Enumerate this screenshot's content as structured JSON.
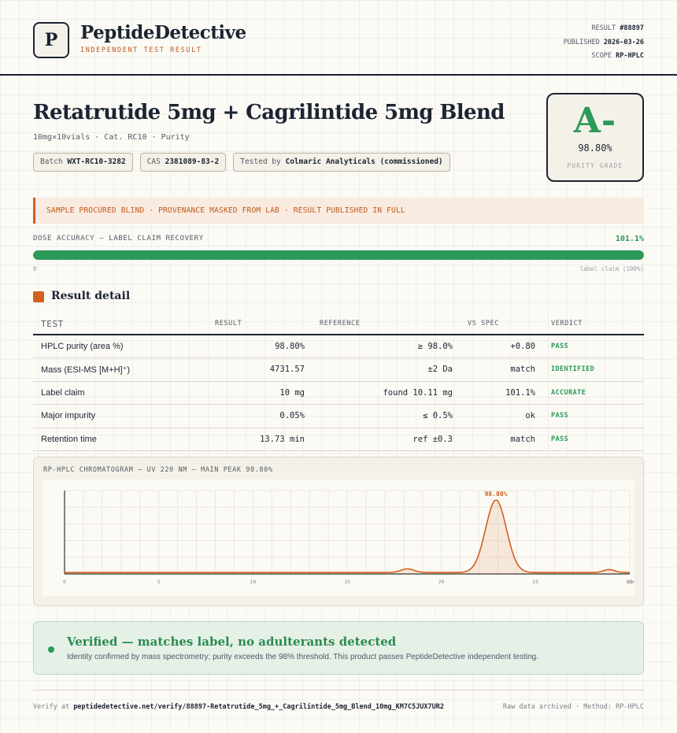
{
  "brand": {
    "logo_letter": "P",
    "name": "PeptideDetective",
    "tagline": "INDEPENDENT TEST RESULT"
  },
  "meta": {
    "result_label": "RESULT",
    "result_value": "#88897",
    "published_label": "PUBLISHED",
    "published_value": "2026-03-26",
    "scope_label": "SCOPE",
    "scope_value": "RP-HPLC"
  },
  "product": {
    "title": "Retatrutide 5mg + Cagrilintide 5mg Blend",
    "subtitle": "10mg×10vials · Cat. RC10 · Purity",
    "chips": [
      {
        "label": "Batch",
        "value": "WXT-RC10-3282"
      },
      {
        "label": "CAS",
        "value": "2381089-83-2"
      },
      {
        "label": "Tested by",
        "value": "Colmaric Analyticals (commissioned)"
      }
    ]
  },
  "grade": {
    "letter": "A-",
    "percent": "98.80%",
    "label": "PURITY GRADE",
    "color": "#2b9a58"
  },
  "banner": {
    "text": "SAMPLE PROCURED BLIND · PROVENANCE MASKED FROM LAB · RESULT PUBLISHED IN FULL"
  },
  "dose": {
    "label": "DOSE ACCURACY — LABEL CLAIM RECOVERY",
    "value": "101.1%",
    "fill_fraction": 1.0,
    "min_label": "0",
    "max_label": "label claim (100%)"
  },
  "detail": {
    "title": "Result detail",
    "columns": [
      "TEST",
      "RESULT",
      "REFERENCE",
      "VS SPEC",
      "VERDICT"
    ],
    "rows": [
      {
        "test": "HPLC purity (area %)",
        "result": "98.80%",
        "reference": "≥ 98.0%",
        "vs_spec": "+0.80",
        "verdict": "PASS"
      },
      {
        "test": "Mass (ESI-MS [M+H]⁺)",
        "result": "4731.57",
        "reference": "±2 Da",
        "vs_spec": "match",
        "verdict": "IDENTIFIED"
      },
      {
        "test": "Label claim",
        "result": "10 mg",
        "reference": "found 10.11 mg",
        "vs_spec": "101.1%",
        "verdict": "ACCURATE"
      },
      {
        "test": "Major impurity",
        "result": "0.05%",
        "reference": "≤ 0.5%",
        "vs_spec": "ok",
        "verdict": "PASS"
      },
      {
        "test": "Retention time",
        "result": "13.73 min",
        "reference": "ref ±0.3",
        "vs_spec": "match",
        "verdict": "PASS"
      }
    ]
  },
  "chart_data": {
    "type": "line",
    "title": "RP-HPLC CHROMATOGRAM — UV 220 NM — MAIN PEAK 98.80%",
    "xlabel": "min",
    "ylabel": "",
    "xlim": [
      0,
      30
    ],
    "ylim": [
      0,
      100
    ],
    "x_ticks": [
      "0",
      "5",
      "10",
      "15",
      "20",
      "25",
      "30"
    ],
    "grid": true,
    "baseline": 2,
    "peaks": [
      {
        "center": 18.2,
        "height": 5,
        "width": 0.35
      },
      {
        "center": 22.9,
        "height": 100,
        "width": 0.55,
        "label": "98.80%"
      },
      {
        "center": 28.9,
        "height": 4,
        "width": 0.3
      }
    ],
    "color": "#d2601f"
  },
  "verified": {
    "title": "Verified — matches label, no adulterants detected",
    "body": "Identity confirmed by mass spectrometry; purity exceeds the 98% threshold. This product passes PeptideDetective independent testing."
  },
  "footer": {
    "verify_prefix": "Verify at",
    "verify_url": "peptidedetective.net/verify/88897-Retatrutide_5mg_+_Cagrilintide_5mg_Blend_10mg_KM7C5JUX7UR2",
    "right": "Raw data archived · Method: RP-HPLC"
  }
}
